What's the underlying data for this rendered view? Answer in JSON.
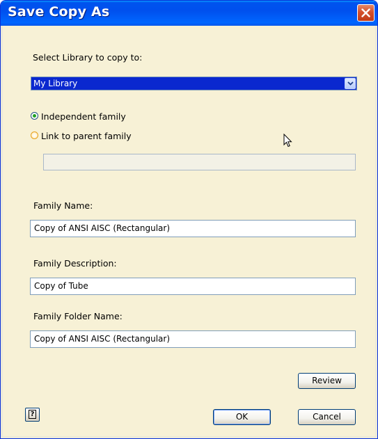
{
  "window": {
    "title": "Save Copy As",
    "close_icon": "close-icon"
  },
  "library": {
    "label": "Select Library to copy to:",
    "selected": "My Library"
  },
  "options": {
    "independent_label": "Independent family",
    "link_label": "Link to parent family",
    "selected": "independent",
    "parent_family_value": ""
  },
  "fields": {
    "name_label": "Family Name:",
    "name_value": "Copy of ANSI AISC (Rectangular)",
    "description_label": "Family Description:",
    "description_value": "Copy of Tube",
    "folder_label": "Family Folder Name:",
    "folder_value": "Copy of ANSI AISC (Rectangular)"
  },
  "buttons": {
    "review": "Review",
    "ok": "OK",
    "cancel": "Cancel",
    "help_glyph": "?"
  },
  "colors": {
    "title_bar": "#0054e3",
    "selection": "#0a28cf",
    "client_bg": "#f7f1d6"
  }
}
